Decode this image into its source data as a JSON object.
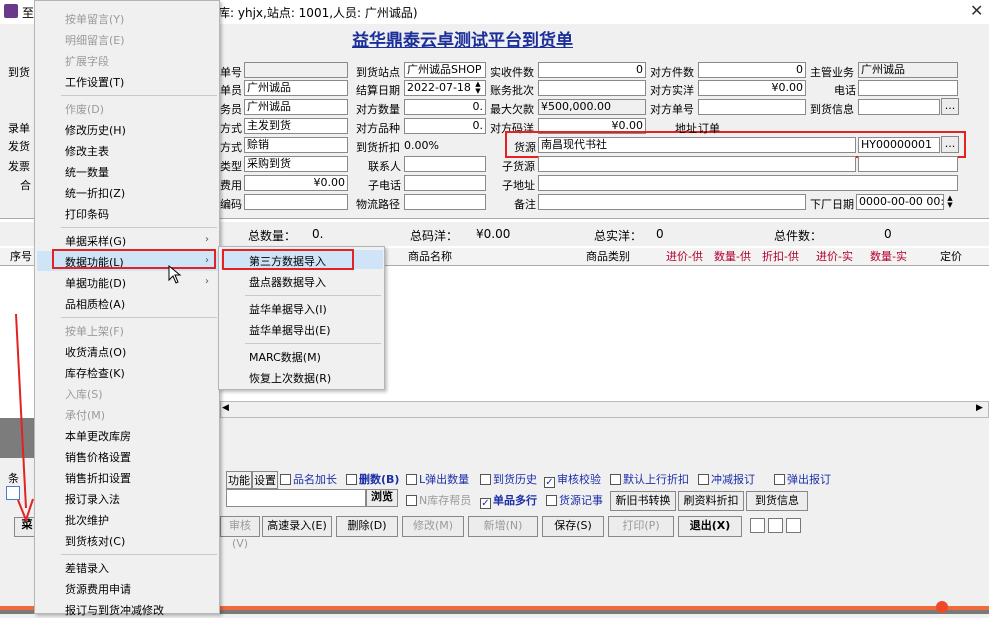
{
  "window": {
    "title_prefix": "至",
    "title": "库: yhjx,站点: 1001,人员: 广州诚品)",
    "form_title": "益华鼎泰云卓测试平台到货单"
  },
  "left_labels": {
    "daohuo": "到货",
    "lu": "录单",
    "fa": "发货",
    "fa_piao": "发票",
    "he": "合"
  },
  "form": {
    "dan_hao_label": "单号",
    "dan_hao_value": "",
    "ye_wu_yuan_label": "单员",
    "ye_wu_yuan_value": "广州诚品",
    "wu_yuan_label": "务员",
    "wu_yuan_value": "广州诚品",
    "fang_shi1_label": "方式",
    "fang_shi1_value": "主发到货",
    "fang_shi2_label": "方式",
    "fang_shi2_value": "赊销",
    "lei_xing_label": "类型",
    "lei_xing_value": "采购到货",
    "fei_yong_label": "费用",
    "fei_yong_value": "¥0.00",
    "bian_ma_label": "编码",
    "bian_ma_value": "",
    "station_label": "到货站点",
    "station_value": "广州诚品SHOP",
    "settle_date_label": "结算日期",
    "settle_date_value": "2022-07-18",
    "peer_qty_label": "对方数量",
    "peer_qty_value": "0.",
    "peer_kinds_label": "对方品种",
    "peer_kinds_value": "0.",
    "discount_label": "到货折扣",
    "discount_value": "0.00%",
    "contact_label": "联系人",
    "contact_value": "",
    "phone_label": "子电话",
    "phone_value": "",
    "logistics_label": "物流路径",
    "logistics_value": "",
    "recv_pieces_label": "实收件数",
    "recv_pieces_value": "0",
    "batch_label": "账务批次",
    "batch_value": "",
    "max_owe_label": "最大欠款",
    "max_owe_value": "¥500,000.00",
    "peer_code_label": "对方码洋",
    "peer_code_value": "¥0.00",
    "source_label": "货源",
    "source_value": "南昌现代书社",
    "source_code": "HY00000001",
    "sub_source_label": "子货源",
    "sub_source_value": "",
    "sub_addr_label": "子地址",
    "sub_addr_value": "",
    "remark_label": "备注",
    "remark_value": "",
    "peer_pieces_label": "对方件数",
    "peer_pieces_value": "0",
    "peer_real_label": "对方实洋",
    "peer_real_value": "¥0.00",
    "peer_no_label": "对方单号",
    "peer_no_value": "",
    "addr_label": "地址",
    "addr_value": "订单",
    "manager_label": "主管业务",
    "manager_value": "广州诚品",
    "tel_label": "电话",
    "tel_value": "",
    "arrival_info_label": "到货信息",
    "arrival_info_value": "",
    "factory_date_label": "下厂日期",
    "factory_date_value": "0000-00-00 00:"
  },
  "summary": {
    "total_qty_label": "总数量：",
    "total_qty_value": "0.",
    "total_code_label": "总码洋：",
    "total_code_value": "¥0.00",
    "total_real_label": "总实洋：",
    "total_real_value": "0",
    "total_pieces_label": "总件数：",
    "total_pieces_value": "0"
  },
  "grid_headers": {
    "seq": "序号",
    "name": "商品名称",
    "category": "商品类别",
    "price_supply": "进价-供",
    "qty_supply": "数量-供",
    "discount_supply": "折扣-供",
    "price_real": "进价-实",
    "qty_real": "数量-实",
    "fixed_price": "定价"
  },
  "options_row": {
    "func": "功能",
    "settings": "设置",
    "name_len": "品名加长",
    "del": "删数(B)",
    "popup_qty": "L弹出数量",
    "history": "到货历史",
    "audit_check": "审核校验",
    "default_discount": "默认上行折扣",
    "offset_report": "冲减报订",
    "popup_report": "弹出报订"
  },
  "second_row": {
    "browse": "浏览",
    "n_stock": "N库存帮员",
    "multi_line": "单品多行",
    "source_record": "货源记事",
    "new_old_convert": "新旧书转换",
    "refresh_discount": "刷资料折扣",
    "arrival_info": "到货信息"
  },
  "action_buttons": {
    "audit": "审核(V)",
    "quick_entry": "高速录入(E)",
    "delete": "删除(D)",
    "modify": "修改(M)",
    "add": "新增(N)",
    "save": "保存(S)",
    "print": "打印(P)",
    "exit": "退出(X)"
  },
  "bottom_left": {
    "tiao": "条",
    "cai": "菜"
  },
  "context_menu": [
    {
      "label": "按单留言(Y)",
      "disabled": true
    },
    {
      "label": "明细留言(E)",
      "disabled": true
    },
    {
      "label": "扩展字段",
      "disabled": true
    },
    {
      "label": "工作设置(T)",
      "disabled": false
    },
    {
      "label": "作废(D)",
      "disabled": true
    },
    {
      "label": "修改历史(H)",
      "disabled": false
    },
    {
      "label": "修改主表",
      "disabled": false
    },
    {
      "label": "统一数量",
      "disabled": false
    },
    {
      "label": "统一折扣(Z)",
      "disabled": false
    },
    {
      "label": "打印条码",
      "disabled": false
    },
    {
      "label": "单据采样(G)",
      "disabled": false,
      "submenu": true
    },
    {
      "label": "数据功能(L)",
      "disabled": false,
      "submenu": true,
      "highlighted": true
    },
    {
      "label": "单据功能(D)",
      "disabled": false,
      "submenu": true
    },
    {
      "label": "品相质检(A)",
      "disabled": false
    },
    {
      "label": "按单上架(F)",
      "disabled": true
    },
    {
      "label": "收货清点(O)",
      "disabled": false
    },
    {
      "label": "库存检查(K)",
      "disabled": false
    },
    {
      "label": "入库(S)",
      "disabled": true
    },
    {
      "label": "承付(M)",
      "disabled": true
    },
    {
      "label": "本单更改库房",
      "disabled": false
    },
    {
      "label": "销售价格设置",
      "disabled": false
    },
    {
      "label": "销售折扣设置",
      "disabled": false
    },
    {
      "label": "报订录入法",
      "disabled": false
    },
    {
      "label": "批次维护",
      "disabled": false
    },
    {
      "label": "到货核对(C)",
      "disabled": false
    },
    {
      "label": "差错录入",
      "disabled": false
    },
    {
      "label": "货源费用申请",
      "disabled": false
    },
    {
      "label": "报订与到货冲减修改",
      "disabled": false
    }
  ],
  "submenu": [
    {
      "label": "第三方数据导入",
      "highlighted": true
    },
    {
      "label": "盘点器数据导入"
    },
    {
      "label": "益华单据导入(I)"
    },
    {
      "label": "益华单据导出(E)"
    },
    {
      "label": "MARC数据(M)"
    },
    {
      "label": "恢复上次数据(R)"
    }
  ],
  "colors": {
    "title_blue": "#1b2f9a",
    "highlight": "#cfe4f7",
    "annotation_red": "#e32222",
    "header_red": "#b3002d"
  }
}
